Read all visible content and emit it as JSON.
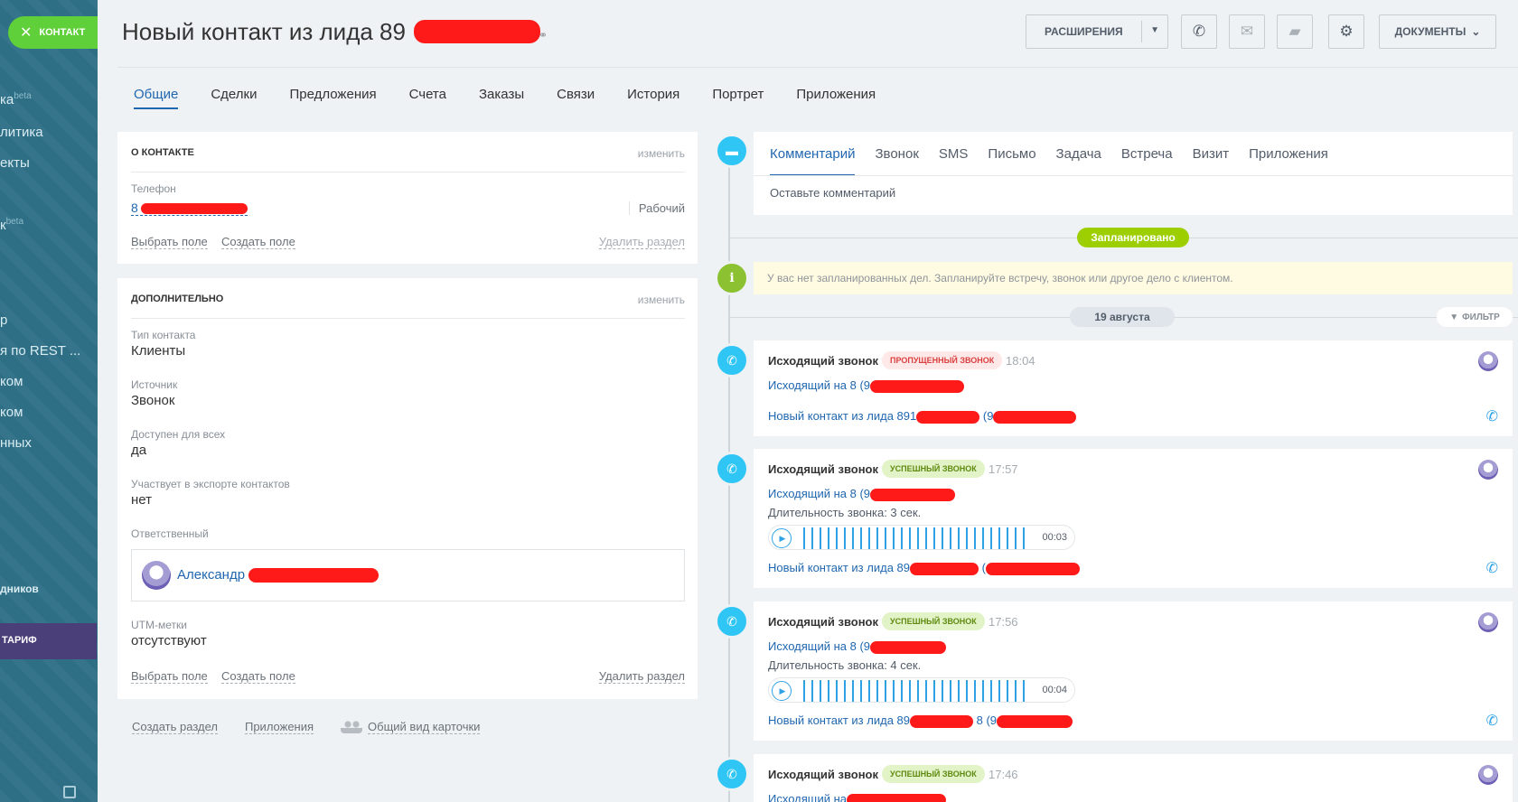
{
  "sidebar": {
    "items": [
      {
        "text": "ка",
        "sup": "beta"
      },
      {
        "text": "литика"
      },
      {
        "text": "екты"
      },
      {
        "text": "к",
        "sup": "beta"
      },
      {
        "text": "р"
      },
      {
        "text": "я по REST ..."
      },
      {
        "text": "ком"
      },
      {
        "text": "ком"
      },
      {
        "text": "нных"
      },
      {
        "text": "дников"
      }
    ],
    "tariff": "ТАРИФ"
  },
  "header": {
    "contact_button": "КОНТАКТ",
    "title": "Новый контакт из лида  89",
    "extensions_label": "РАСШИРЕНИЯ",
    "documents_label": "ДОКУМЕНТЫ"
  },
  "tabs": [
    "Общие",
    "Сделки",
    "Предложения",
    "Счета",
    "Заказы",
    "Связи",
    "История",
    "Портрет",
    "Приложения"
  ],
  "about": {
    "heading": "О КОНТАКТЕ",
    "edit": "изменить",
    "phone_label": "Телефон",
    "phone_value": "8",
    "phone_type": "Рабочий",
    "select_field": "Выбрать поле",
    "create_field": "Создать поле",
    "delete_section": "Удалить раздел"
  },
  "extra": {
    "heading": "ДОПОЛНИТЕЛЬНО",
    "edit": "изменить",
    "fields": [
      {
        "label": "Тип контакта",
        "value": "Клиенты"
      },
      {
        "label": "Источник",
        "value": "Звонок"
      },
      {
        "label": "Доступен для всех",
        "value": "да"
      },
      {
        "label": "Участвует в экспорте контактов",
        "value": "нет"
      }
    ],
    "responsible_label": "Ответственный",
    "responsible_name": "Александр",
    "utm_label": "UTM-метки",
    "utm_value": "отсутствуют",
    "select_field": "Выбрать поле",
    "create_field": "Создать поле",
    "delete_section": "Удалить раздел"
  },
  "bottom_links": {
    "create_section": "Создать раздел",
    "applications": "Приложения",
    "common_view": "Общий вид карточки"
  },
  "timeline": {
    "comment_tabs": [
      "Комментарий",
      "Звонок",
      "SMS",
      "Письмо",
      "Задача",
      "Встреча",
      "Визит",
      "Приложения"
    ],
    "comment_placeholder": "Оставьте комментарий",
    "planned": "Запланировано",
    "notice": "У вас нет запланированных дел. Запланируйте встречу, звонок или другое дело с клиентом.",
    "date": "19 августа",
    "filter": "ФИЛЬТР",
    "calls": [
      {
        "title": "Исходящий звонок",
        "badge": "ПРОПУЩЕННЫЙ ЗВОНОК",
        "status": "missed",
        "time": "18:04",
        "link1": "Исходящий на 8 (9",
        "link2": "Новый контакт из лида 891",
        "link2_suffix": "(9"
      },
      {
        "title": "Исходящий звонок",
        "badge": "УСПЕШНЫЙ ЗВОНОК",
        "status": "ok",
        "time": "17:57",
        "link1": "Исходящий на 8 (9",
        "duration": "Длительность звонка: 3 сек.",
        "player_time": "00:03",
        "link2": "Новый контакт из лида 89",
        "link2_suffix": "("
      },
      {
        "title": "Исходящий звонок",
        "badge": "УСПЕШНЫЙ ЗВОНОК",
        "status": "ok",
        "time": "17:56",
        "link1": "Исходящий на 8 (9",
        "duration": "Длительность звонка: 4 сек.",
        "player_time": "00:04",
        "link2": "Новый контакт из лида 89",
        "link2_suffix": "8 (9"
      },
      {
        "title": "Исходящий звонок",
        "badge": "УСПЕШНЫЙ ЗВОНОК",
        "status": "ok",
        "time": "17:46",
        "link1": "Исходящий на"
      }
    ]
  },
  "colors": {
    "sidebar": "#2e6f86",
    "accent_blue": "#2067b0",
    "contact_green": "#5fcf3a",
    "timeline_icon": "#2fc6f6",
    "planned_green": "#9dcf00",
    "redaction": "#ff1a1a"
  }
}
